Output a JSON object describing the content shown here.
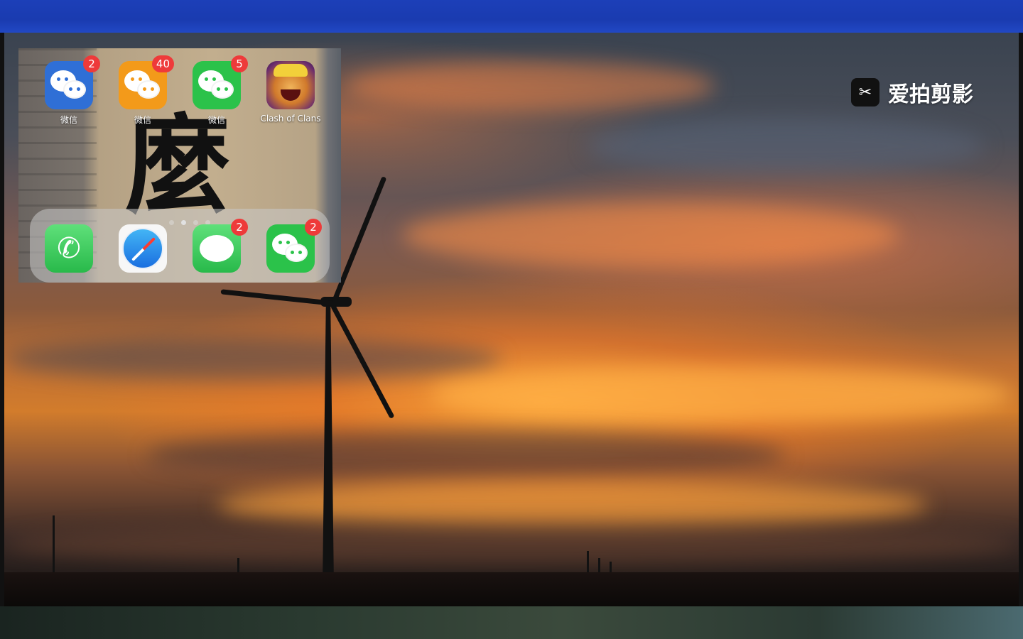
{
  "watermark": {
    "logo_icon": "scissors-icon",
    "text": "爱拍剪影"
  },
  "phone_screen": {
    "home_apps": [
      {
        "label": "微信",
        "icon": "wechat-icon",
        "badge": "2",
        "color": "#2f6fd6"
      },
      {
        "label": "微信",
        "icon": "wechat-icon",
        "badge": "40",
        "color": "#f39a1a"
      },
      {
        "label": "微信",
        "icon": "wechat-icon",
        "badge": "5",
        "color": "#2bc24a"
      },
      {
        "label": "Clash of Clans",
        "icon": "clash-of-clans-icon",
        "badge": "",
        "color": "#6a2c6e"
      }
    ],
    "dock_apps": [
      {
        "icon": "phone-icon",
        "badge": "",
        "color": "#34c759"
      },
      {
        "icon": "safari-icon",
        "badge": "",
        "color": "#ffffff"
      },
      {
        "icon": "messages-icon",
        "badge": "2",
        "color": "#34c759"
      },
      {
        "icon": "wechat-icon",
        "badge": "2",
        "color": "#2bc24a"
      }
    ],
    "page_dots": {
      "count": 4,
      "active_index": 1
    },
    "wallpaper_glyph": "麼"
  },
  "colors": {
    "badge": "#ee3a3a",
    "top_bar": "#1c3fb8"
  }
}
